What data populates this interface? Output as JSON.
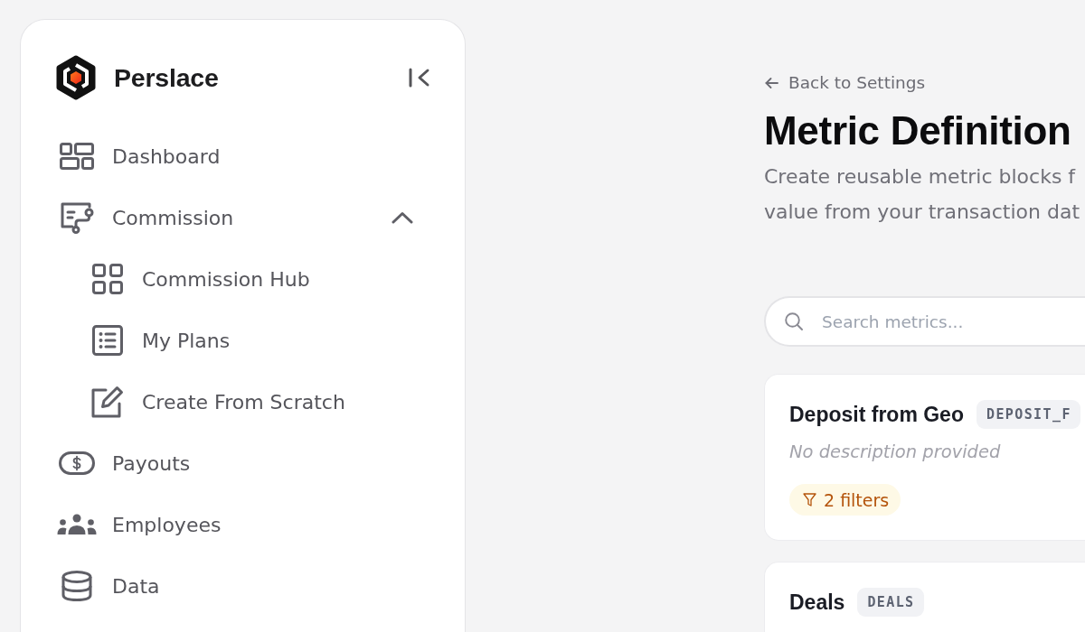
{
  "sidebar": {
    "brand": "Perslace",
    "items": [
      {
        "label": "Dashboard",
        "selected": false
      },
      {
        "label": "Commission",
        "selected": false,
        "expanded": true,
        "children": [
          {
            "label": "Commission Hub",
            "selected": false
          },
          {
            "label": "My Plans",
            "selected": false
          },
          {
            "label": "Create From Scratch",
            "selected": false
          }
        ]
      },
      {
        "label": "Payouts",
        "selected": false
      },
      {
        "label": "Employees",
        "selected": false
      },
      {
        "label": "Data",
        "selected": false
      }
    ]
  },
  "page": {
    "back_link": "Back to Settings",
    "title": "Metric Definition",
    "description": [
      "Create reusable metric blocks f",
      "value from your transaction dat"
    ]
  },
  "search": {
    "placeholder": "Search metrics..."
  },
  "metrics": [
    {
      "name": "Deposit from Geo",
      "code": "DEPOSIT_F",
      "description": "No description provided",
      "filters": "2 filters"
    },
    {
      "name": "Deals",
      "code": "DEALS"
    }
  ]
}
